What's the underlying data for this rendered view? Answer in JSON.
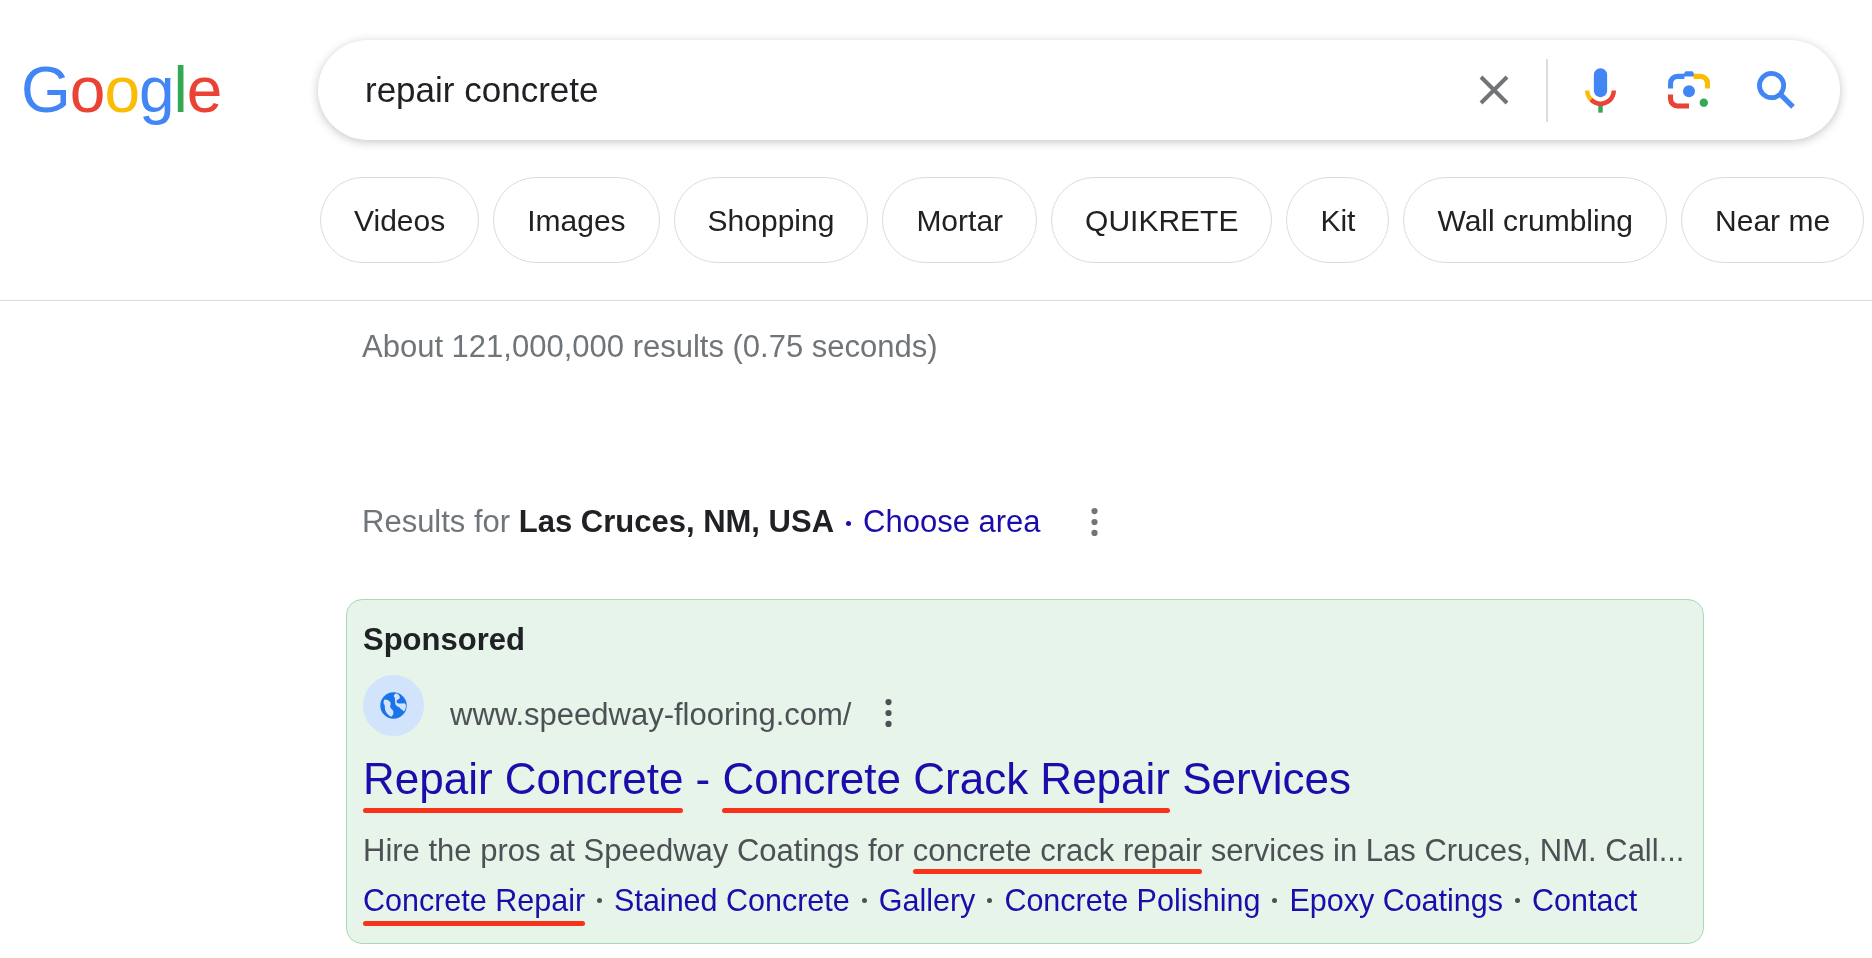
{
  "logo": "Google",
  "search": {
    "value": "repair concrete"
  },
  "chips": [
    {
      "label": "Videos"
    },
    {
      "label": "Images"
    },
    {
      "label": "Shopping"
    },
    {
      "label": "Mortar"
    },
    {
      "label": "QUIKRETE"
    },
    {
      "label": "Kit"
    },
    {
      "label": "Wall crumbling"
    },
    {
      "label": "Near me"
    }
  ],
  "result_stats": "About 121,000,000 results (0.75 seconds)",
  "location": {
    "text": "Results for **Las Cruces, NM, USA**",
    "link": "Choose area"
  },
  "ad": {
    "label": "Sponsored",
    "url": "www.speedway-flooring.com/",
    "title": [
      {
        "text": "Repair Concrete",
        "annotated": true
      },
      {
        "text": " - ",
        "annotated": false
      },
      {
        "text": "Concrete Crack Repair",
        "annotated": true
      },
      {
        "text": " Services",
        "annotated": false
      }
    ],
    "description": [
      {
        "text": "Hire the pros at Speedway Coatings for ",
        "annotated": false
      },
      {
        "text": "concrete crack repair",
        "annotated": true
      },
      {
        "text": " services in Las Cruces, NM. Call...",
        "annotated": false
      }
    ],
    "sitelinks": [
      {
        "text": "Concrete Repair",
        "annotated": true
      },
      {
        "text": "Stained Concrete",
        "annotated": false
      },
      {
        "text": "Gallery",
        "annotated": false
      },
      {
        "text": "Concrete Polishing",
        "annotated": false
      },
      {
        "text": "Epoxy Coatings",
        "annotated": false
      },
      {
        "text": "Contact",
        "annotated": false
      }
    ]
  }
}
